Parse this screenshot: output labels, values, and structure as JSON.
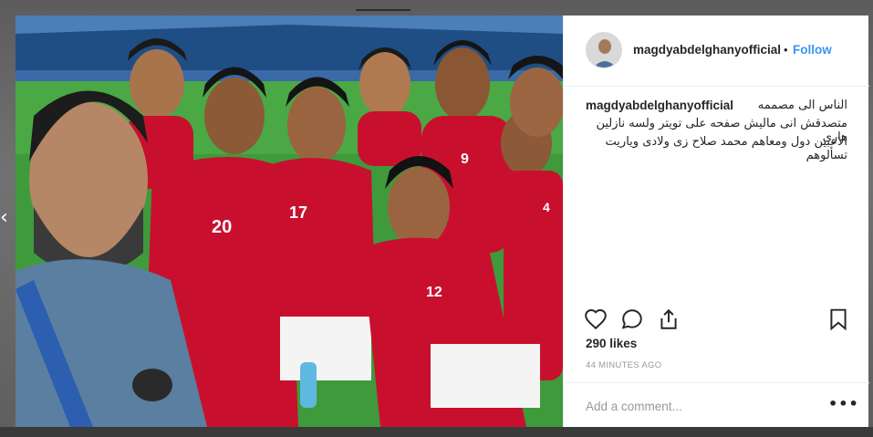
{
  "post": {
    "username": "magdyabdelghanyofficial",
    "separator": "•",
    "follow_label": "Follow",
    "caption": {
      "username": "magdyabdelghanyofficial",
      "line1": "الناس الى مصممه",
      "line2": "متصدقش انى ماليش صفحه على تويتر ولسه نازلين هارى",
      "line3": "الاعبين دول ومعاهم محمد صلاح زى ولادى وياريت تسألوهم"
    },
    "likes": "290 likes",
    "timestamp": "44 MINUTES AGO",
    "add_comment_placeholder": "Add a comment...",
    "more_label": "•••"
  },
  "photo": {
    "jersey_numbers": [
      "20",
      "17",
      "9",
      "12",
      "4"
    ]
  },
  "icons": {
    "like": "heart-icon",
    "comment": "comment-icon",
    "share": "share-icon",
    "save": "bookmark-icon",
    "nav": "chevron-left-icon"
  },
  "colors": {
    "follow": "#3897f0",
    "text": "#262626",
    "muted": "#999999",
    "jersey": "#c8102e"
  }
}
